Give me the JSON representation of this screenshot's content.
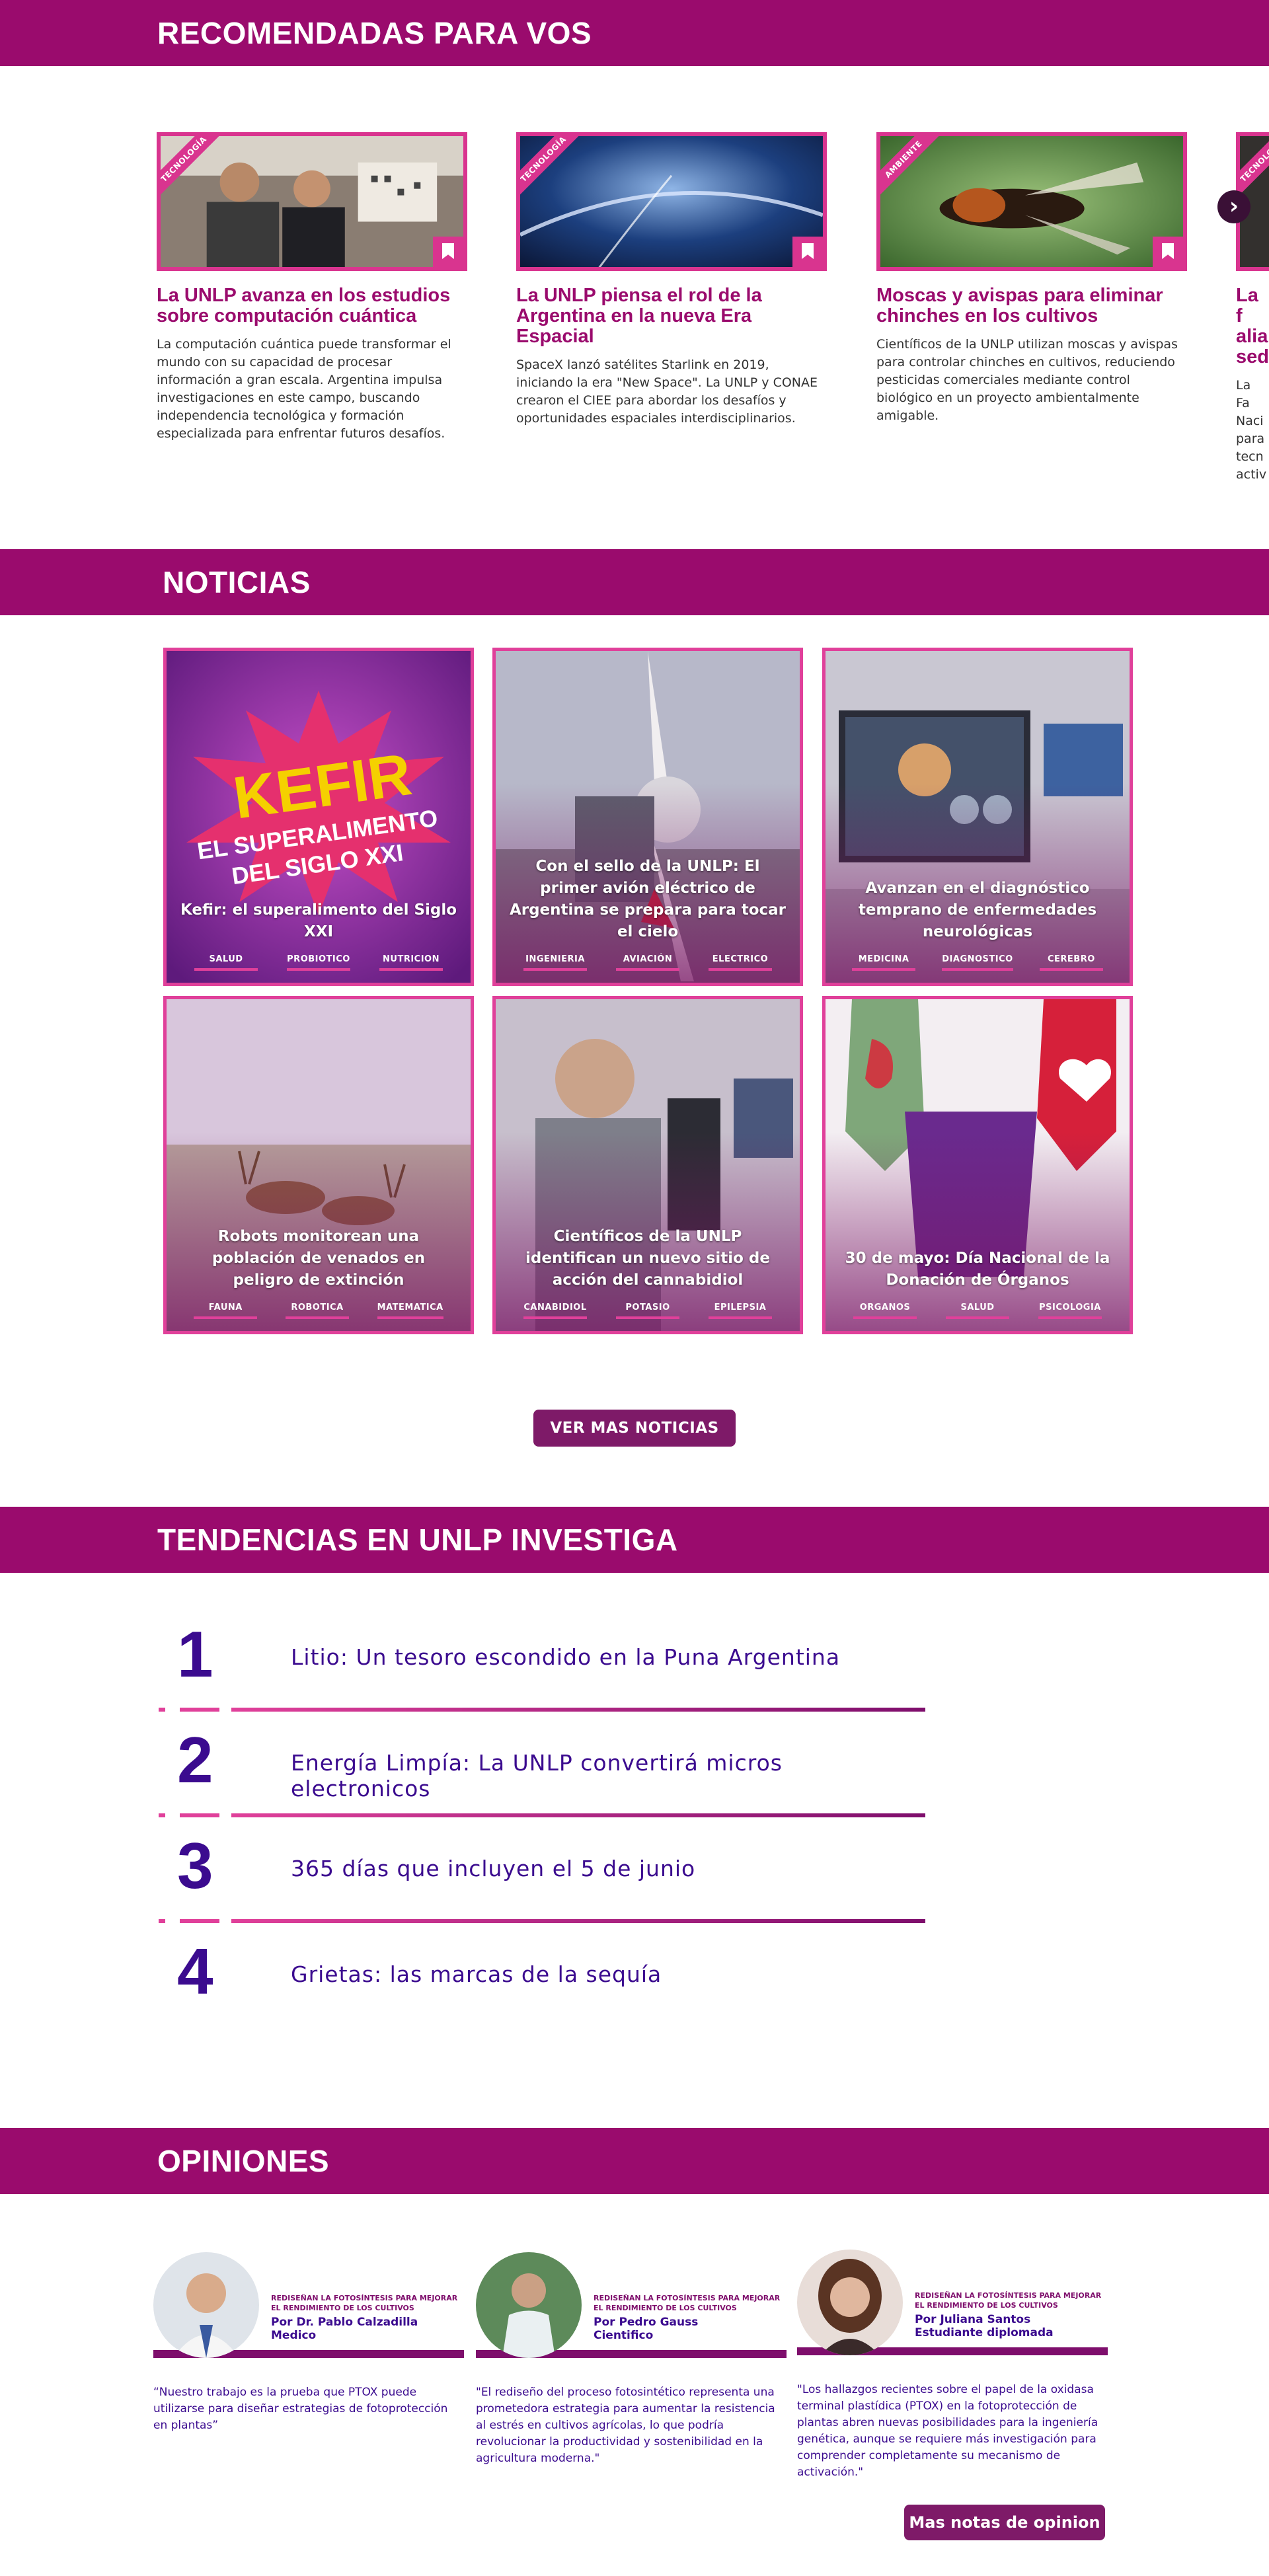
{
  "recomendadas": {
    "heading": "RECOMENDADAS PARA VOS",
    "cards": [
      {
        "category": "TECNOLOGÍA",
        "title": "La UNLP avanza en los estudios sobre computación cuántica",
        "text": "La computación cuántica puede transformar el mundo con su capacidad de procesar información a gran escala. Argentina impulsa investigaciones en este campo, buscando independencia tecnológica y formación especializada para enfrentar futuros desafíos."
      },
      {
        "category": "TECNOLOGÍA",
        "title": "La UNLP piensa el rol de la Argentina en la nueva Era Espacial",
        "text": "SpaceX lanzó satélites Starlink en 2019, iniciando la era \"New Space\". La UNLP y CONAE crearon el CIEE para abordar los desafíos y oportunidades espaciales interdisciplinarios."
      },
      {
        "category": "AMBIENTE",
        "title": "Moscas y avispas para eliminar chinches en los cultivos",
        "text": "Científicos de la UNLP utilizan moscas y avispas para controlar chinches en cultivos, reduciendo pesticidas comerciales mediante control biológico en un proyecto ambientalmente amigable."
      },
      {
        "category": "TECNOLOGÍA",
        "title": "La f alia sed",
        "text": "La Fa Naci para tecn activ"
      }
    ]
  },
  "noticias": {
    "heading": "NOTICIAS",
    "cards": [
      {
        "title": "Kefir: el superalimento del Siglo XXI",
        "tags": [
          "SALUD",
          "PROBIOTICO",
          "NUTRICION"
        ],
        "poster_line1": "KEFIR",
        "poster_line2": "EL SUPERALIMENTO",
        "poster_line3": "DEL SIGLO XXI"
      },
      {
        "title": "Con el sello de la UNLP: El primer avión eléctrico de Argentina se prepara para tocar el cielo",
        "tags": [
          "INGENIERIA",
          "AVIACIÓN",
          "ELECTRICO"
        ]
      },
      {
        "title": "Avanzan en el diagnóstico temprano de enfermedades neurológicas",
        "tags": [
          "MEDICINA",
          "DIAGNOSTICO",
          "CEREBRO"
        ]
      },
      {
        "title": "Robots monitorean una población de venados en peligro de extinción",
        "tags": [
          "FAUNA",
          "ROBOTICA",
          "MATEMATICA"
        ]
      },
      {
        "title": "Científicos de la UNLP identifican un nuevo sitio de acción del cannabidiol",
        "tags": [
          "CANABIDIOL",
          "POTASIO",
          "EPILEPSIA"
        ]
      },
      {
        "title": "30 de mayo: Día Nacional de la Donación de Órganos",
        "tags": [
          "ORGANOS",
          "SALUD",
          "PSICOLOGIA"
        ]
      }
    ],
    "more_button": "VER MAS NOTICIAS"
  },
  "tendencias": {
    "heading": "TENDENCIAS EN UNLP INVESTIGA",
    "items": [
      {
        "number": "1",
        "text": "Litio: Un tesoro escondido en la Puna Argentina"
      },
      {
        "number": "2",
        "text": "Energía Limpía: La UNLP convertirá micros electronicos"
      },
      {
        "number": "3",
        "text": "365 días que incluyen el 5 de junio"
      },
      {
        "number": "4",
        "text": "Grietas: las marcas de la sequía"
      }
    ]
  },
  "opiniones": {
    "heading": "OPINIONES",
    "cards": [
      {
        "topic": "REDISEÑAN LA FOTOSÍNTESIS PARA MEJORAR EL RENDIMIENTO DE LOS CULTIVOS",
        "name": "Por Dr. Pablo Calzadilla",
        "role": "Medico",
        "quote": "“Nuestro trabajo es la prueba que PTOX puede utilizarse para diseñar estrategias de fotoprotección en plantas”"
      },
      {
        "topic": "REDISEÑAN LA FOTOSÍNTESIS PARA MEJORAR EL RENDIMIENTO DE LOS CULTIVOS",
        "name": "Por Pedro Gauss",
        "role": "Cientifico",
        "quote": "\"El rediseño del proceso fotosintético representa una prometedora estrategia para aumentar la resistencia al estrés en cultivos agrícolas, lo que podría revolucionar la productividad y sostenibilidad en la agricultura moderna.\""
      },
      {
        "topic": "REDISEÑAN LA FOTOSÍNTESIS PARA MEJORAR EL RENDIMIENTO DE LOS CULTIVOS",
        "name": "Por Juliana Santos",
        "role": "Estudiante diplomada",
        "quote": "\"Los hallazgos recientes sobre el papel de la oxidasa terminal plastídica (PTOX) en la fotoprotección de plantas abren nuevas posibilidades para la ingeniería genética, aunque se requiere más investigación para comprender completamente su mecanismo de activación.\""
      }
    ],
    "more_button": "Mas notas de opinion >>"
  },
  "colors": {
    "brand": "#9a0b6d",
    "accent": "#d9348f",
    "trend": "#3b0b8f"
  }
}
